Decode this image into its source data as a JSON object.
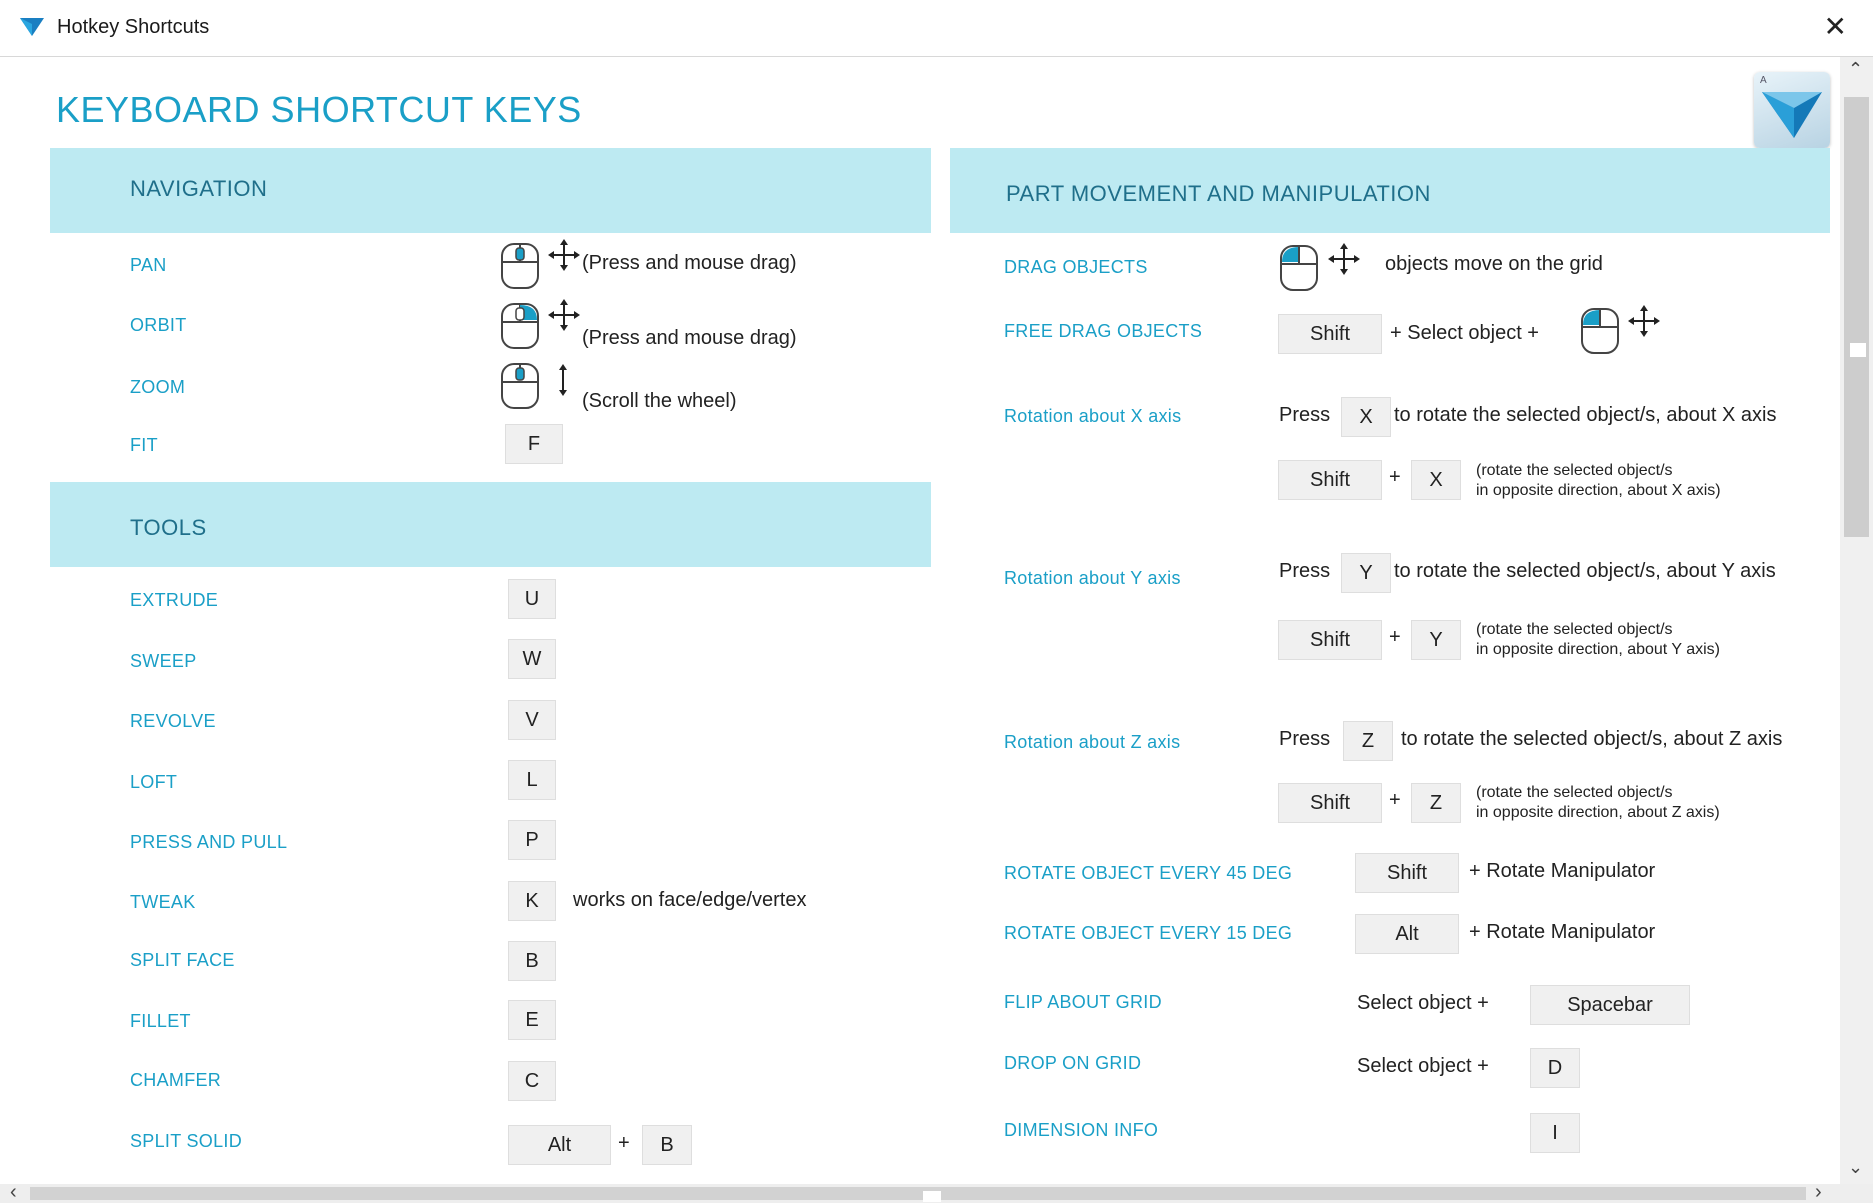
{
  "window": {
    "title": "Hotkey Shortcuts",
    "close": "✕"
  },
  "heading": "KEYBOARD SHORTCUT KEYS",
  "navigation": {
    "title": "NAVIGATION",
    "pan": {
      "label": "PAN",
      "hint": "(Press and mouse drag)"
    },
    "orbit": {
      "label": "ORBIT",
      "hint": "(Press and mouse drag)"
    },
    "zoom": {
      "label": "ZOOM",
      "hint": "(Scroll the wheel)"
    },
    "fit": {
      "label": "FIT",
      "key": "F"
    }
  },
  "tools": {
    "title": "TOOLS",
    "items": [
      {
        "label": "EXTRUDE",
        "key": "U"
      },
      {
        "label": "SWEEP",
        "key": "W"
      },
      {
        "label": "REVOLVE",
        "key": "V"
      },
      {
        "label": "LOFT",
        "key": "L"
      },
      {
        "label": "PRESS AND PULL",
        "key": "P"
      },
      {
        "label": "TWEAK",
        "key": "K",
        "note": "works on face/edge/vertex"
      },
      {
        "label": "SPLIT FACE",
        "key": "B"
      },
      {
        "label": "FILLET",
        "key": "E"
      },
      {
        "label": "CHAMFER",
        "key": "C"
      },
      {
        "label": "SPLIT SOLID",
        "key": "Alt",
        "key2": "B"
      }
    ]
  },
  "part": {
    "title": "PART MOVEMENT AND MANIPULATION",
    "drag": {
      "label": "DRAG OBJECTS",
      "text": "objects move on the grid"
    },
    "free_drag": {
      "label": "FREE DRAG OBJECTS",
      "key": "Shift",
      "text": "+ Select object +"
    },
    "rot_x": {
      "label": "Rotation about X axis",
      "press": "Press",
      "key": "X",
      "text": "to rotate the selected object/s, about X axis",
      "shift": "Shift",
      "plus": "+",
      "key2": "X",
      "note1": "(rotate the selected object/s",
      "note2": "in opposite direction, about X axis)"
    },
    "rot_y": {
      "label": "Rotation about Y axis",
      "press": "Press",
      "key": "Y",
      "text": "to rotate the selected object/s, about Y axis",
      "shift": "Shift",
      "plus": "+",
      "key2": "Y",
      "note1": "(rotate the selected object/s",
      "note2": "in opposite direction, about Y axis)"
    },
    "rot_z": {
      "label": "Rotation about Z axis",
      "press": "Press",
      "key": "Z",
      "text": "to rotate the selected object/s, about Z axis",
      "shift": "Shift",
      "plus": "+",
      "key2": "Z",
      "note1": "(rotate the selected object/s",
      "note2": "in opposite direction, about Z axis)"
    },
    "rot45": {
      "label": "ROTATE OBJECT EVERY 45 DEG",
      "key": "Shift",
      "text": "+ Rotate Manipulator"
    },
    "rot15": {
      "label": "ROTATE OBJECT EVERY 15 DEG",
      "key": "Alt",
      "text": "+ Rotate Manipulator"
    },
    "flip": {
      "label": "FLIP ABOUT GRID",
      "text": "Select object +",
      "key": "Spacebar"
    },
    "drop": {
      "label": "DROP ON GRID",
      "text": "Select object +",
      "key": "D"
    },
    "dim": {
      "label": "DIMENSION INFO",
      "key": "I"
    }
  },
  "colors": {
    "accent": "#1a9fc7",
    "section_bg": "#bdeaf2",
    "key_bg": "#f0f0f0"
  }
}
